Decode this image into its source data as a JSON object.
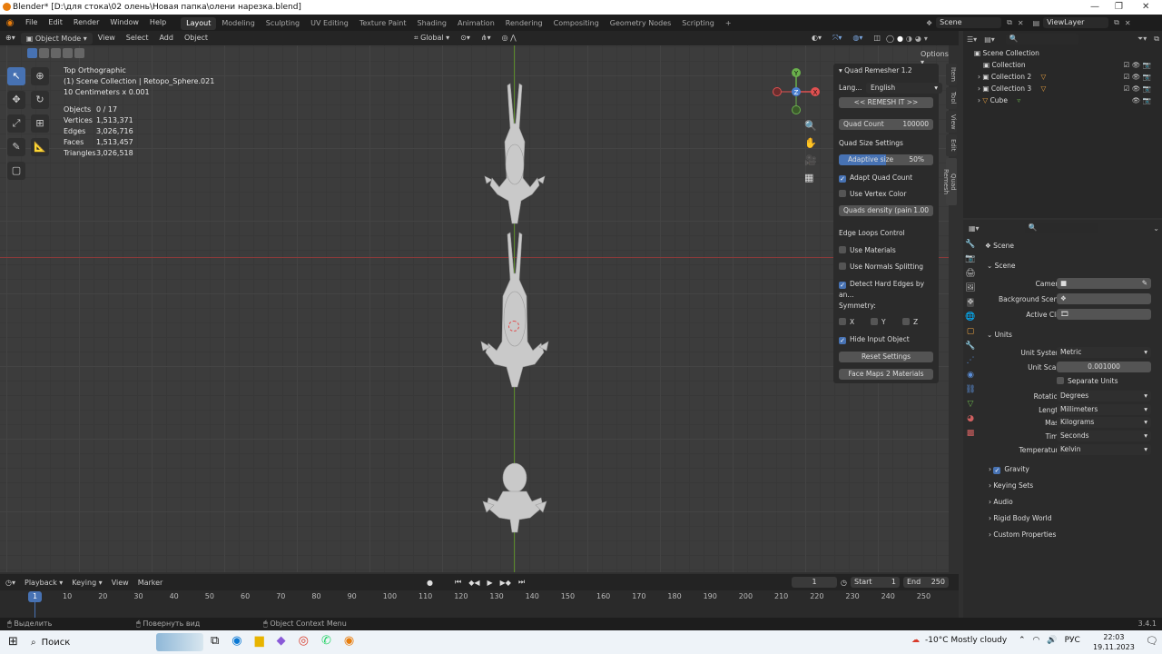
{
  "title_bar": {
    "title": "Blender* [D:\\для стока\\02 олень\\Новая папка\\олени нарезка.blend]"
  },
  "menu": [
    "File",
    "Edit",
    "Render",
    "Window",
    "Help"
  ],
  "workspaces": [
    "Layout",
    "Modeling",
    "Sculpting",
    "UV Editing",
    "Texture Paint",
    "Shading",
    "Animation",
    "Rendering",
    "Compositing",
    "Geometry Nodes",
    "Scripting"
  ],
  "scene": {
    "scene_name": "Scene",
    "view_layer": "ViewLayer"
  },
  "viewport_header": {
    "mode": "Object Mode",
    "menus": [
      "View",
      "Select",
      "Add",
      "Object"
    ],
    "transform": "Global",
    "options": "Options"
  },
  "overlay_info": {
    "view": "Top Orthographic",
    "collection": "(1) Scene Collection | Retopo_Sphere.021",
    "scale": "10 Centimeters x 0.001",
    "stats": [
      {
        "label": "Objects",
        "value": "0 / 17"
      },
      {
        "label": "Vertices",
        "value": "1,513,371"
      },
      {
        "label": "Edges",
        "value": "3,026,716"
      },
      {
        "label": "Faces",
        "value": "1,513,457"
      },
      {
        "label": "Triangles",
        "value": "3,026,518"
      }
    ]
  },
  "npanel": {
    "title": "Quad Remesher 1.2",
    "lang_label": "Lang...",
    "lang_value": "English",
    "remesh_button": "<< REMESH IT >>",
    "quad_count_label": "Quad Count",
    "quad_count_value": "100000",
    "quad_size_header": "Quad Size Settings",
    "adaptive_label": "Adaptive size",
    "adaptive_value": "50%",
    "adaptive_fraction": 0.5,
    "adapt_quad_count": "Adapt Quad Count",
    "use_vertex_color": "Use Vertex Color",
    "density_label": "Quads density (pain",
    "density_value": "1.00",
    "edge_loops_header": "Edge Loops Control",
    "use_materials": "Use Materials",
    "use_normals": "Use Normals Splitting",
    "detect_hard": "Detect Hard Edges by an...",
    "symmetry_label": "Symmetry:",
    "sym_x": "X",
    "sym_y": "Y",
    "sym_z": "Z",
    "hide_input": "Hide Input Object",
    "reset": "Reset Settings",
    "face_maps": "Face Maps 2 Materials",
    "tabs": [
      "Item",
      "Tool",
      "View",
      "Edit",
      "Quad Remesh"
    ]
  },
  "outliner": {
    "root": "Scene Collection",
    "items": [
      "Collection",
      "Collection 2",
      "Collection 3",
      "Cube"
    ]
  },
  "properties": {
    "breadcrumb": "Scene",
    "scene_section": "Scene",
    "camera_label": "Camera",
    "bg_scene_label": "Background Scene",
    "active_clip_label": "Active Clip",
    "units_section": "Units",
    "unit_system_label": "Unit System",
    "unit_system": "Metric",
    "unit_scale_label": "Unit Scale",
    "unit_scale": "0.001000",
    "separate_units": "Separate Units",
    "rotation_label": "Rotation",
    "rotation": "Degrees",
    "length_label": "Length",
    "length": "Millimeters",
    "mass_label": "Mass",
    "mass": "Kilograms",
    "time_label": "Time",
    "time": "Seconds",
    "temperature_label": "Temperature",
    "temperature": "Kelvin",
    "collapsed": [
      "Gravity",
      "Keying Sets",
      "Audio",
      "Rigid Body World",
      "Custom Properties"
    ]
  },
  "timeline": {
    "menus": [
      "Playback",
      "Keying",
      "View",
      "Marker"
    ],
    "current_frame": "1",
    "start_label": "Start",
    "start": "1",
    "end_label": "End",
    "end": "250",
    "ticks": [
      "10",
      "20",
      "30",
      "40",
      "50",
      "60",
      "70",
      "80",
      "90",
      "100",
      "110",
      "120",
      "130",
      "140",
      "150",
      "160",
      "170",
      "180",
      "190",
      "200",
      "210",
      "220",
      "230",
      "240",
      "250"
    ]
  },
  "status_bar": {
    "select": "Выделить",
    "rotate": "Повернуть вид",
    "context": "Object Context Menu",
    "version": "3.4.1"
  },
  "taskbar": {
    "search": "Поиск",
    "weather": "-10°C  Mostly cloudy",
    "lang": "РУС",
    "time": "22:03",
    "date": "19.11.2023"
  }
}
